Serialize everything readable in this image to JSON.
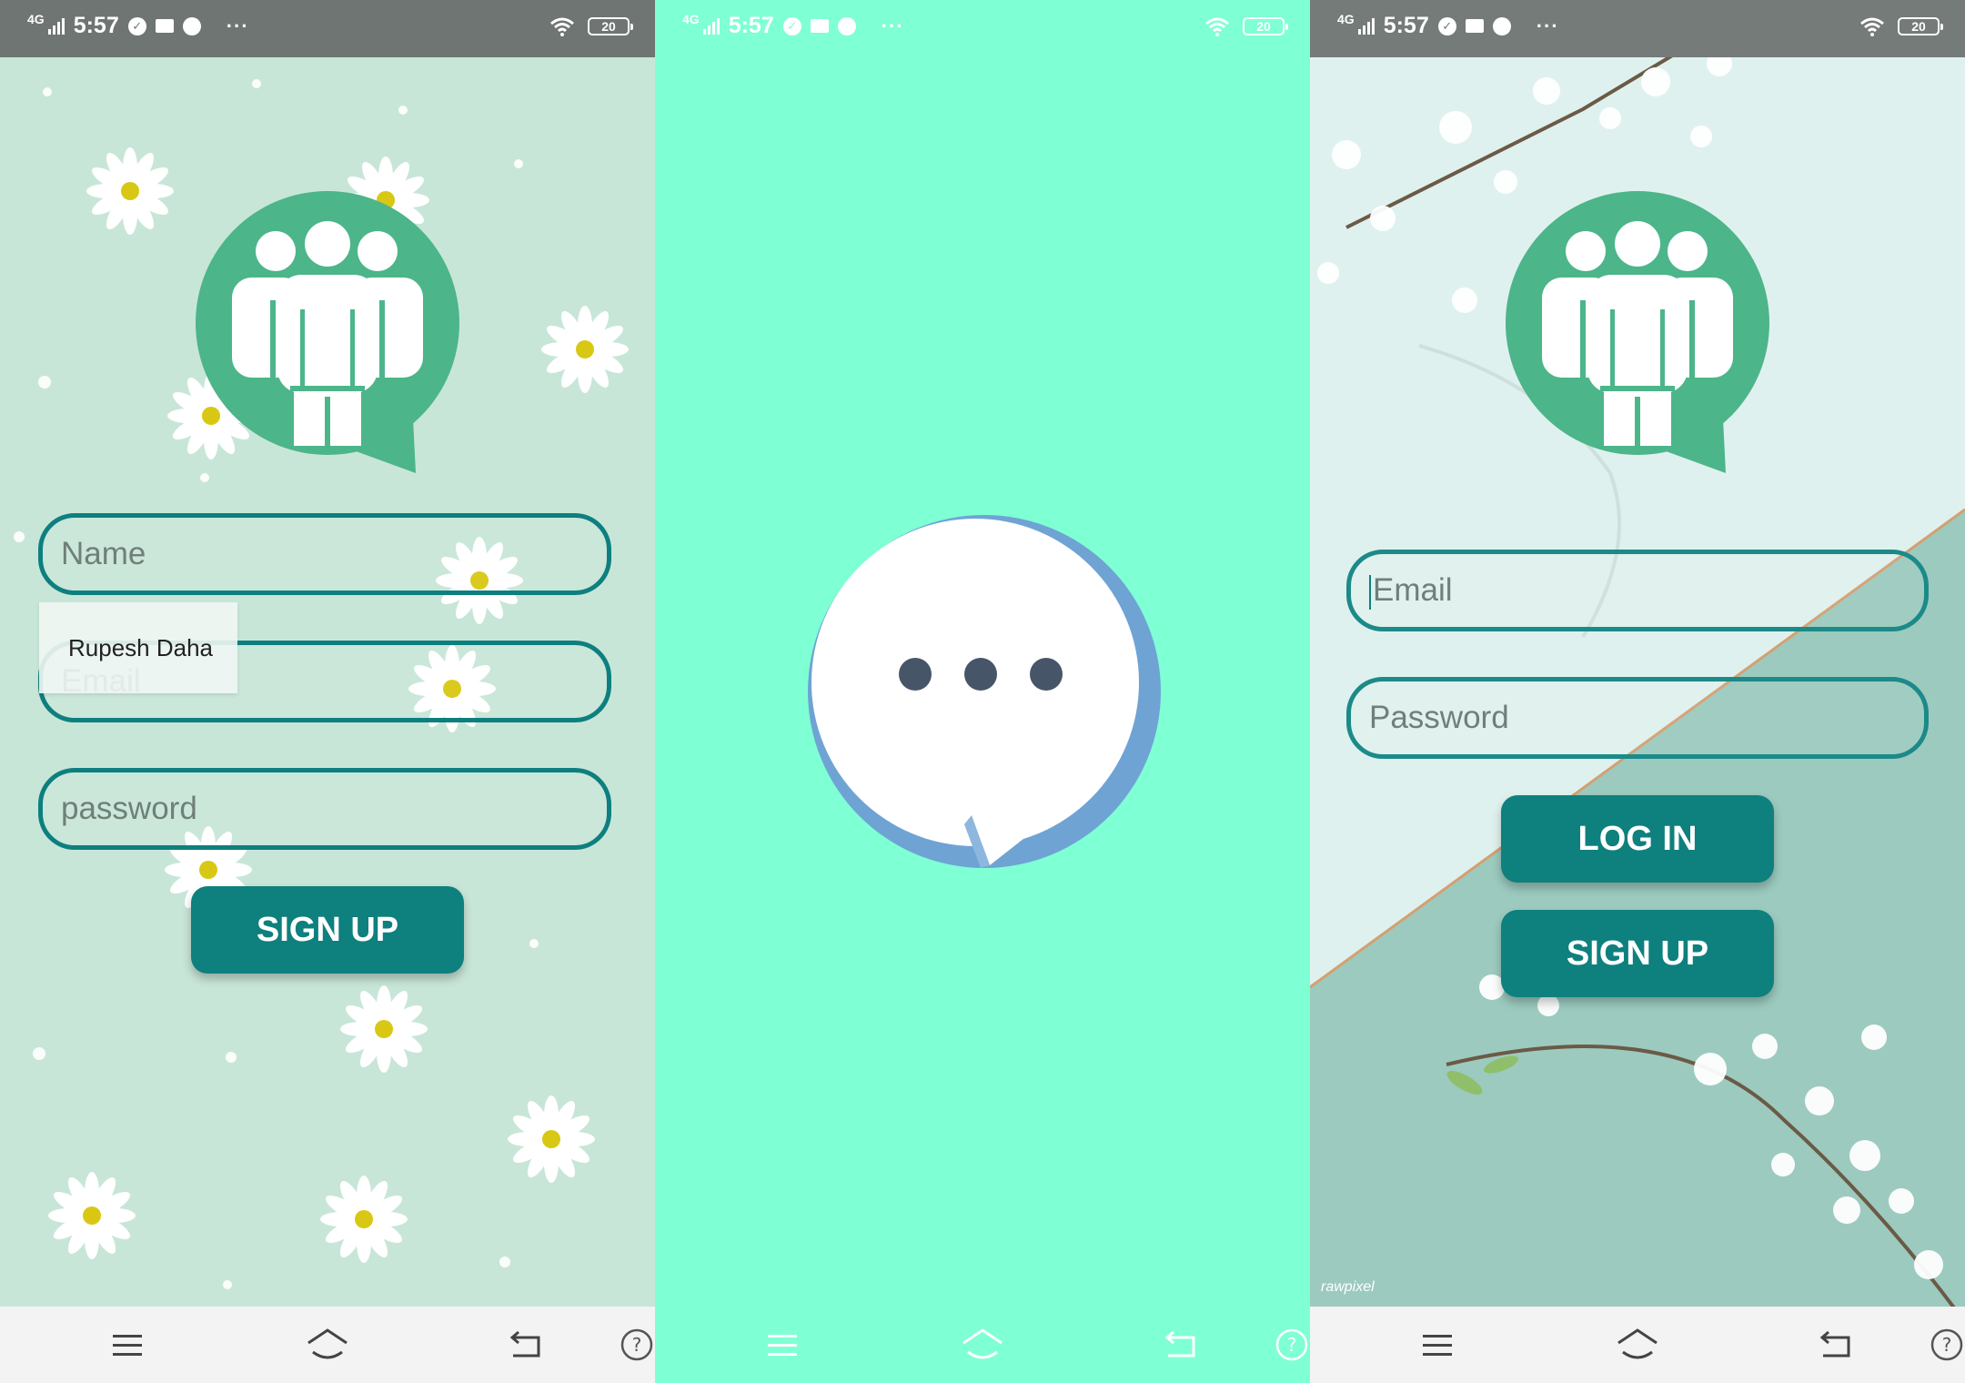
{
  "status_bar": {
    "network_type": "4G",
    "time": "5:57",
    "overflow": "···",
    "battery": "20",
    "icons": [
      "signal-icon",
      "alarm-icon",
      "mail-icon",
      "chat-icon",
      "wifi-icon",
      "battery-icon"
    ]
  },
  "signup_screen": {
    "name_placeholder": "Name",
    "email_placeholder": "Email",
    "password_placeholder": "password",
    "autofill_suggestion": "Rupesh Daha",
    "signup_button": "SIGN UP"
  },
  "splash_screen": {
    "icon": "chat-bubble-loading-icon"
  },
  "login_screen": {
    "email_placeholder": "Email",
    "password_placeholder": "Password",
    "login_button": "LOG IN",
    "signup_button": "SIGN UP",
    "watermark": "rawpixel"
  },
  "nav_bar": {
    "icons": [
      "menu-icon",
      "home-icon",
      "back-icon",
      "help-icon"
    ]
  },
  "colors": {
    "teal": "#0e807e",
    "logo_green": "#4cb58a",
    "splash_bg": "#7fffd4",
    "signup_bg": "#c8e6d8"
  }
}
